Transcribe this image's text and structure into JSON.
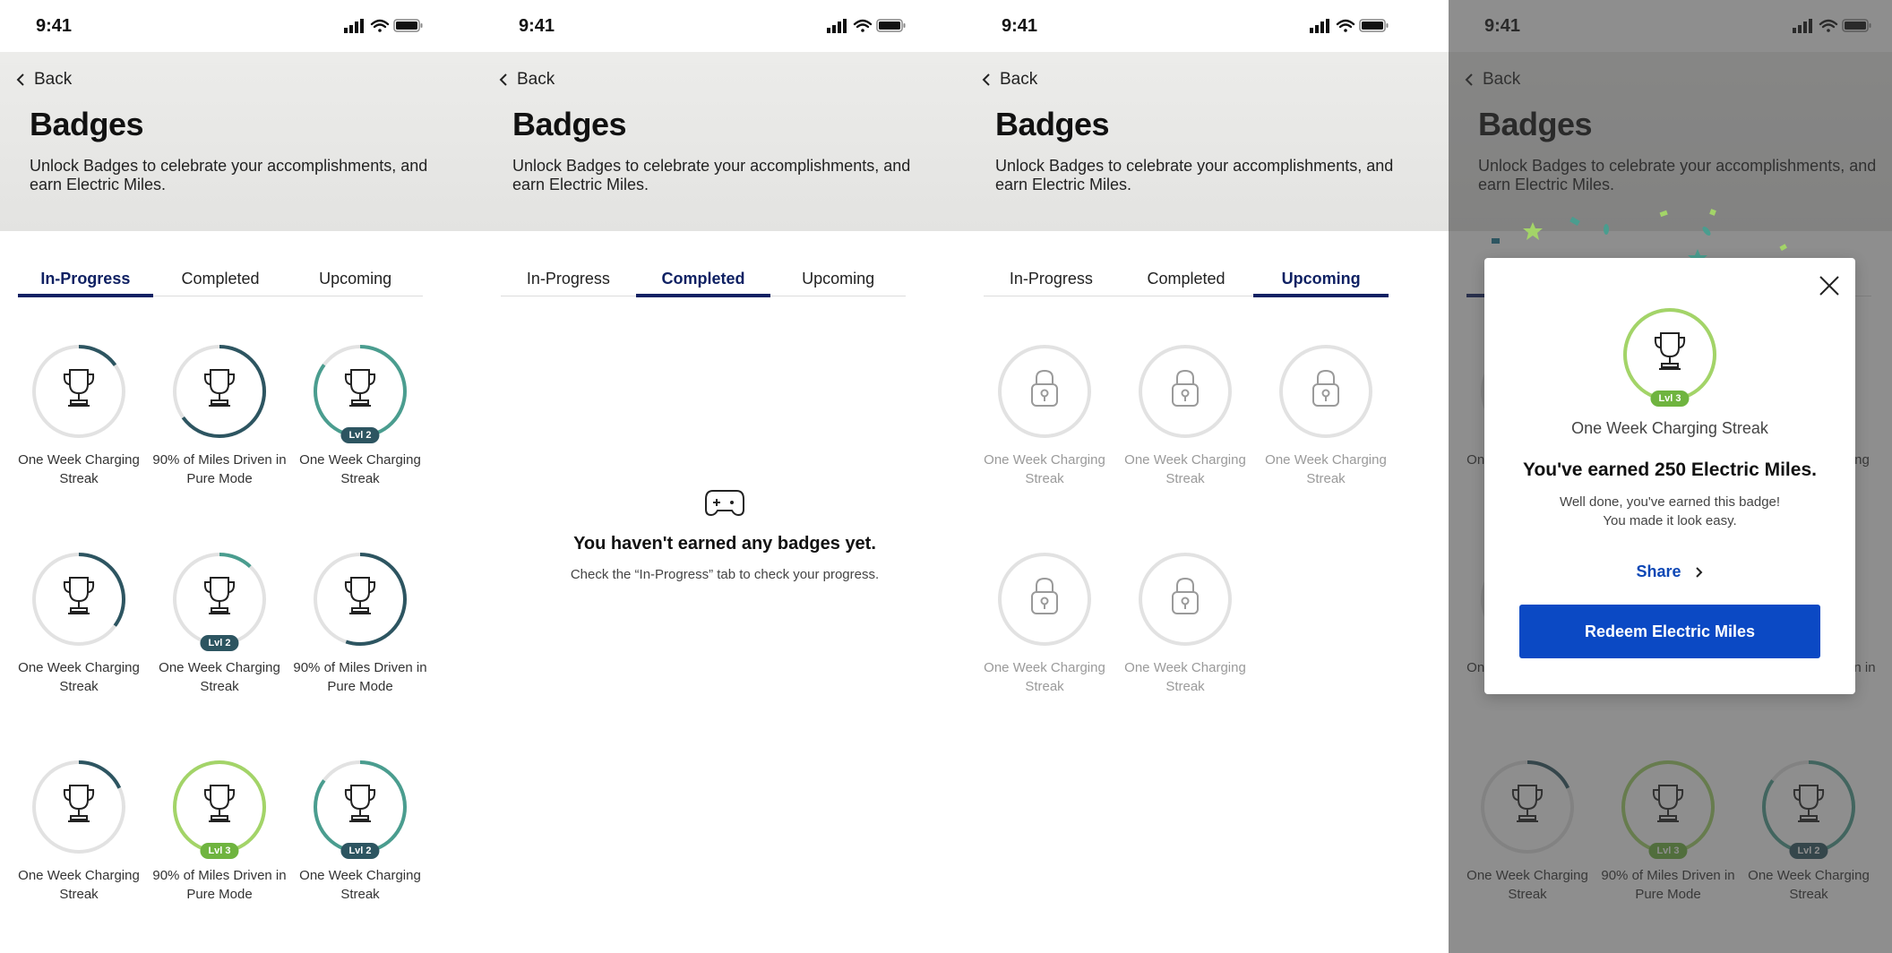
{
  "status": {
    "time": "9:41"
  },
  "header": {
    "back_label": "Back",
    "title": "Badges",
    "subtitle": "Unlock Badges to celebrate your accomplishments, and earn Electric Miles."
  },
  "tabs": [
    "In-Progress",
    "Completed",
    "Upcoming"
  ],
  "in_progress_badges": [
    {
      "label": "One Week Charging Streak",
      "progress": 0.15,
      "color": "#2d5561",
      "level": ""
    },
    {
      "label": "90% of Miles Driven in Pure Mode",
      "progress": 0.65,
      "color": "#2d5561",
      "level": ""
    },
    {
      "label": "One Week Charging Streak",
      "progress": 0.85,
      "color": "#4a9d8f",
      "level": "Lvl 2"
    },
    {
      "label": "One Week Charging Streak",
      "progress": 0.35,
      "color": "#2d5561",
      "level": ""
    },
    {
      "label": "One Week Charging Streak",
      "progress": 0.12,
      "color": "#4a9d8f",
      "level": "Lvl 2"
    },
    {
      "label": "90% of Miles Driven in Pure Mode",
      "progress": 0.55,
      "color": "#2d5561",
      "level": ""
    },
    {
      "label": "One Week Charging Streak",
      "progress": 0.18,
      "color": "#2d5561",
      "level": ""
    },
    {
      "label": "90% of Miles Driven in Pure Mode",
      "progress": 1.0,
      "color": "#a3d468",
      "level": "Lvl 3"
    },
    {
      "label": "One Week Charging Streak",
      "progress": 0.85,
      "color": "#4a9d8f",
      "level": "Lvl 2"
    }
  ],
  "completed_empty": {
    "title": "You haven't earned any badges yet.",
    "subtitle": "Check the “In-Progress” tab to check your progress."
  },
  "upcoming_badges": [
    {
      "label": "One Week Charging Streak"
    },
    {
      "label": "One Week Charging Streak"
    },
    {
      "label": "One Week Charging Streak"
    },
    {
      "label": "One Week Charging Streak"
    },
    {
      "label": "One Week Charging Streak"
    }
  ],
  "modal": {
    "badge_name": "One Week Charging Streak",
    "level": "Lvl 3",
    "earned": "You've earned 250 Electric Miles.",
    "message_line1": "Well done, you've earned this badge!",
    "message_line2": "You made it look easy.",
    "share_label": "Share",
    "redeem_label": "Redeem Electric Miles"
  },
  "colors": {
    "accent_navy": "#0f2163",
    "button_blue": "#0b49c4",
    "teal_dark": "#2d5561",
    "teal_light": "#4a9d8f",
    "green": "#a3d468"
  },
  "icons": [
    "chevron-left-icon",
    "trophy-icon",
    "lock-icon",
    "game-controller-icon",
    "close-icon",
    "chevron-right-icon",
    "signal-icon",
    "wifi-icon",
    "battery-icon"
  ]
}
